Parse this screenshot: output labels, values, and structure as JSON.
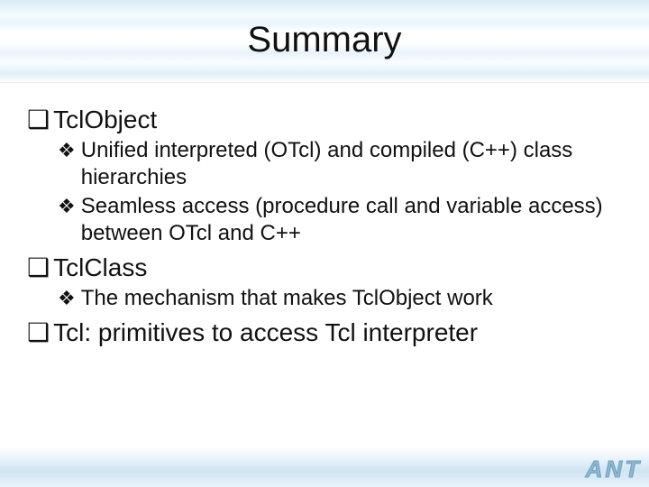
{
  "title": "Summary",
  "brand": "ANT",
  "bullets": [
    {
      "text": "TclObject",
      "children": [
        "Unified interpreted (OTcl) and compiled (C++) class hierarchies",
        "Seamless access (procedure call and variable access) between OTcl and C++"
      ]
    },
    {
      "text": "TclClass",
      "children": [
        "The mechanism that makes TclObject work"
      ]
    },
    {
      "text": "Tcl: primitives to access Tcl interpreter",
      "children": []
    }
  ]
}
